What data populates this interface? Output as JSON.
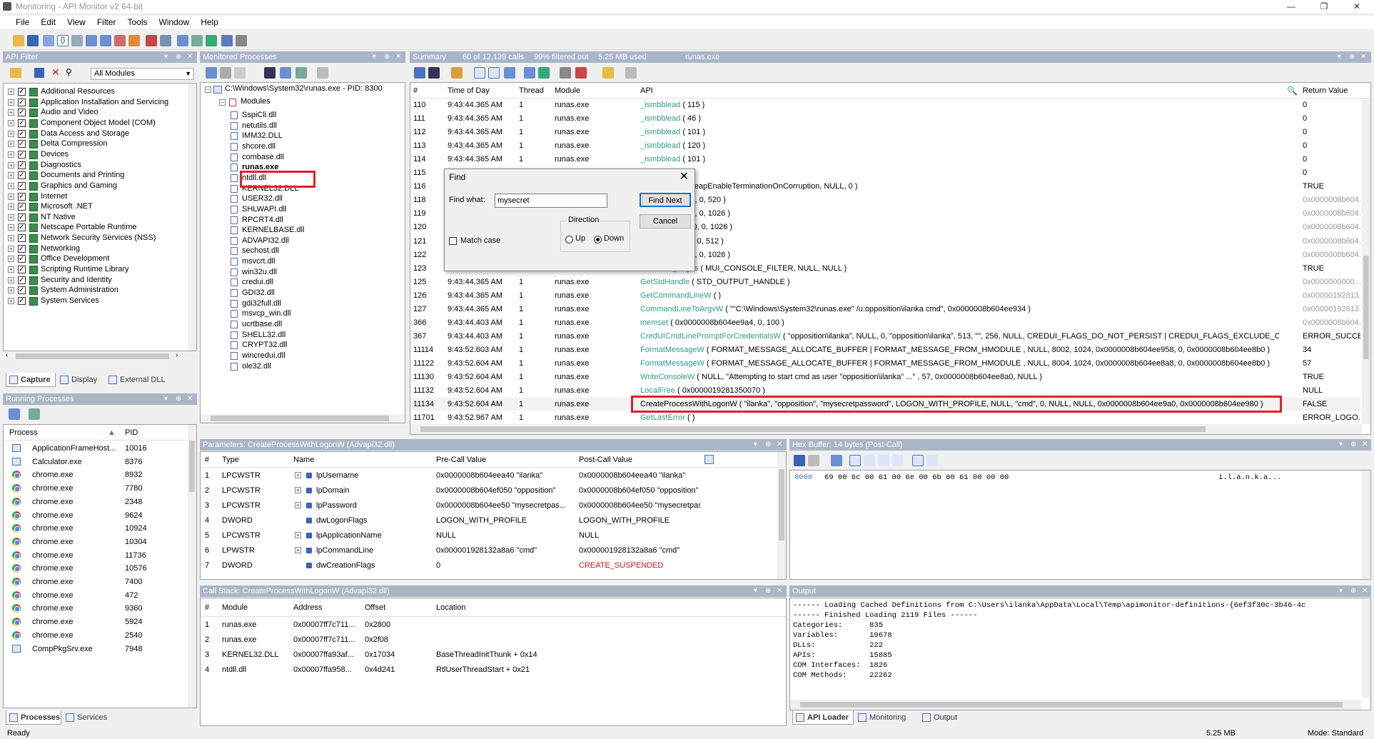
{
  "window": {
    "title": "Monitoring - API Monitor v2 64-bit"
  },
  "menu": [
    "File",
    "Edit",
    "View",
    "Filter",
    "Tools",
    "Window",
    "Help"
  ],
  "api_filter": {
    "header": "API Filter",
    "dropdown": "All Modules",
    "items": [
      "Additional Resources",
      "Application Installation and Servicing",
      "Audio and Video",
      "Component Object Model (COM)",
      "Data Access and Storage",
      "Delta Compression",
      "Devices",
      "Diagnostics",
      "Documents and Printing",
      "Graphics and Gaming",
      "Internet",
      "Microsoft .NET",
      "NT Native",
      "Netscape Portable Runtime",
      "Network Security Services (NSS)",
      "Networking",
      "Office Development",
      "Scripting Runtime Library",
      "Security and Identity",
      "System Administration",
      "System Services"
    ],
    "tabs": [
      "Capture",
      "Display",
      "External DLL"
    ]
  },
  "monitored": {
    "header": "Monitored Processes",
    "root": "C:\\Windows\\System32\\runas.exe - PID: 8300",
    "modules_label": "Modules",
    "modules": [
      "SspiCli.dll",
      "netutils.dll",
      "IMM32.DLL",
      "shcore.dll",
      "combase.dll",
      "runas.exe",
      "ntdll.dll",
      "KERNEL32.DLL",
      "USER32.dll",
      "SHLWAPI.dll",
      "RPCRT4.dll",
      "KERNELBASE.dll",
      "ADVAPI32.dll",
      "sechost.dll",
      "msvcrt.dll",
      "win32u.dll",
      "credui.dll",
      "GDI32.dll",
      "gdi32full.dll",
      "msvcp_win.dll",
      "ucrtbase.dll",
      "SHELL32.dll",
      "CRYPT32.dll",
      "wincredui.dll",
      "ole32.dll"
    ]
  },
  "running": {
    "header": "Running Processes",
    "col_process": "Process",
    "col_pid": "PID",
    "rows": [
      {
        "name": "ApplicationFrameHost...",
        "pid": "10016",
        "icon": "window-icon"
      },
      {
        "name": "Calculator.exe",
        "pid": "8376",
        "icon": "window-icon"
      },
      {
        "name": "chrome.exe",
        "pid": "8932",
        "icon": "chrome-icon"
      },
      {
        "name": "chrome.exe",
        "pid": "7780",
        "icon": "chrome-icon"
      },
      {
        "name": "chrome.exe",
        "pid": "2348",
        "icon": "chrome-icon"
      },
      {
        "name": "chrome.exe",
        "pid": "9624",
        "icon": "chrome-icon"
      },
      {
        "name": "chrome.exe",
        "pid": "10924",
        "icon": "chrome-icon"
      },
      {
        "name": "chrome.exe",
        "pid": "10304",
        "icon": "chrome-icon"
      },
      {
        "name": "chrome.exe",
        "pid": "11736",
        "icon": "chrome-icon"
      },
      {
        "name": "chrome.exe",
        "pid": "10576",
        "icon": "chrome-icon"
      },
      {
        "name": "chrome.exe",
        "pid": "7400",
        "icon": "chrome-icon"
      },
      {
        "name": "chrome.exe",
        "pid": "472",
        "icon": "chrome-icon"
      },
      {
        "name": "chrome.exe",
        "pid": "9360",
        "icon": "chrome-icon"
      },
      {
        "name": "chrome.exe",
        "pid": "5924",
        "icon": "chrome-icon"
      },
      {
        "name": "chrome.exe",
        "pid": "2540",
        "icon": "chrome-icon"
      },
      {
        "name": "CompPkgSrv.exe",
        "pid": "7948",
        "icon": "window-icon"
      }
    ],
    "tabs": [
      "Processes",
      "Services"
    ]
  },
  "summary": {
    "header_parts": [
      "Summary",
      "60 of 12,139 calls",
      "99% filtered out",
      "5.25 MB used",
      "runas.exe"
    ],
    "columns": [
      "#",
      "Time of Day",
      "Thread",
      "Module",
      "API",
      "Return Value"
    ],
    "rows": [
      {
        "n": "110",
        "t": "9:43:44.365 AM",
        "th": "1",
        "m": "runas.exe",
        "api": "_ismbblead",
        "args": " ( 115 )",
        "ret": "0"
      },
      {
        "n": "111",
        "t": "9:43:44.365 AM",
        "th": "1",
        "m": "runas.exe",
        "api": "_ismbblead",
        "args": " ( 46 )",
        "ret": "0"
      },
      {
        "n": "112",
        "t": "9:43:44.365 AM",
        "th": "1",
        "m": "runas.exe",
        "api": "_ismbblead",
        "args": " ( 101 )",
        "ret": "0"
      },
      {
        "n": "113",
        "t": "9:43:44.365 AM",
        "th": "1",
        "m": "runas.exe",
        "api": "_ismbblead",
        "args": " ( 120 )",
        "ret": "0"
      },
      {
        "n": "114",
        "t": "9:43:44.365 AM",
        "th": "1",
        "m": "runas.exe",
        "api": "_ismbblead",
        "args": " ( 101 )",
        "ret": "0"
      },
      {
        "n": "115",
        "t": "",
        "th": "",
        "m": "",
        "api": "",
        "args": "",
        "ret": "0"
      },
      {
        "n": "116",
        "t": "",
        "th": "",
        "m": "",
        "api": "ation",
        "args": " ( NULL, HeapEnableTerminationOnCorruption, NULL, 0 )",
        "ret": "TRUE"
      },
      {
        "n": "118",
        "t": "",
        "th": "",
        "m": "",
        "api": "",
        "args": "0008b604ef050, 0, 520 )",
        "ret": "0x0000008b604..."
      },
      {
        "n": "119",
        "t": "",
        "th": "",
        "m": "",
        "api": "",
        "args": "0008b604ef260, 0, 1026 )",
        "ret": "0x0000008b604..."
      },
      {
        "n": "120",
        "t": "",
        "th": "",
        "m": "",
        "api": "",
        "args": "0008b604eea40, 0, 1026 )",
        "ret": "0x0000008b604..."
      },
      {
        "n": "121",
        "t": "",
        "th": "",
        "m": "",
        "api": "",
        "args": "0008b604ee50, 0, 512 )",
        "ret": "0x0000008b604..."
      },
      {
        "n": "122",
        "t": "",
        "th": "",
        "m": "",
        "api": "",
        "args": "0008b604ef670, 0, 1026 )",
        "ret": "0x0000008b604..."
      },
      {
        "n": "123",
        "t": "",
        "th": "",
        "m": "",
        "api": "redUILanguages",
        "args": " ( MUI_CONSOLE_FILTER, NULL, NULL )",
        "ret": "TRUE"
      },
      {
        "n": "125",
        "t": "9:43:44.365 AM",
        "th": "1",
        "m": "runas.exe",
        "api": "GetStdHandle",
        "args": " ( STD_OUTPUT_HANDLE )",
        "ret": "0x0000000000..."
      },
      {
        "n": "126",
        "t": "9:43:44.365 AM",
        "th": "1",
        "m": "runas.exe",
        "api": "GetCommandLineW",
        "args": " ( )",
        "ret": "0x00000192813..."
      },
      {
        "n": "127",
        "t": "9:43:44.365 AM",
        "th": "1",
        "m": "runas.exe",
        "api": "CommandLineToArgvW",
        "args": " ( \"\"C:\\Windows\\System32\\runas.exe\" /u:opposition\\ilanka cmd\", 0x0000008b604ee934 )",
        "ret": "0x00000192813..."
      },
      {
        "n": "366",
        "t": "9:43:44.403 AM",
        "th": "1",
        "m": "runas.exe",
        "api": "memset",
        "args": " ( 0x0000008b604ee9a4, 0, 100 )",
        "ret": "0x0000008b604..."
      },
      {
        "n": "367",
        "t": "9:43:44.403 AM",
        "th": "1",
        "m": "runas.exe",
        "api": "CredUICmdLinePromptForCredentialsW",
        "args": " ( \"opposition\\ilanka\", NULL, 0, \"opposition\\ilanka\", 513, \"\", 256, NULL, CREDUI_FLAGS_DO_NOT_PERSIST | CREDUI_FLAGS_EXCLUDE_CERTIF...",
        "ret": "ERROR_SUCCESS"
      },
      {
        "n": "11114",
        "t": "9:43:52.603 AM",
        "th": "1",
        "m": "runas.exe",
        "api": "FormatMessageW",
        "args": " ( FORMAT_MESSAGE_ALLOCATE_BUFFER | FORMAT_MESSAGE_FROM_HMODULE , NULL, 8002, 1024, 0x0000008b604ee958, 0, 0x0000008b604ee8b0 )",
        "ret": "34"
      },
      {
        "n": "11122",
        "t": "9:43:52.604 AM",
        "th": "1",
        "m": "runas.exe",
        "api": "FormatMessageW",
        "args": " ( FORMAT_MESSAGE_ALLOCATE_BUFFER | FORMAT_MESSAGE_FROM_HMODULE , NULL, 8004, 1024, 0x0000008b604ee8a8, 0, 0x0000008b604ee8b0 )",
        "ret": "57"
      },
      {
        "n": "11130",
        "t": "9:43:52.604 AM",
        "th": "1",
        "m": "runas.exe",
        "api": "WriteConsoleW",
        "args": " ( NULL, \"Attempting to start cmd as user \"opposition\\ilanka\" ...\" , 57, 0x0000008b604ee8a0, NULL )",
        "ret": "TRUE"
      },
      {
        "n": "11132",
        "t": "9:43:52.604 AM",
        "th": "1",
        "m": "runas.exe",
        "api": "LocalFree",
        "args": " ( 0x0000019281350070 )",
        "ret": "NULL"
      },
      {
        "n": "11134",
        "t": "9:43:52.604 AM",
        "th": "1",
        "m": "runas.exe",
        "api": "CreateProcessWithLogonW",
        "args": " ( \"ilanka\", \"opposition\", \"mysecretpassword\", LOGON_WITH_PROFILE, NULL, \"cmd\", 0, NULL, NULL, 0x0000008b604ee9a0, 0x0000008b604ee980 )",
        "ret": "FALSE"
      },
      {
        "n": "11701",
        "t": "9:43:52.967 AM",
        "th": "1",
        "m": "runas.exe",
        "api": "GetLastError",
        "args": " ( )",
        "ret": "ERROR_LOGO..."
      }
    ]
  },
  "find": {
    "title": "Find",
    "label": "Find what:",
    "value": "mysecret",
    "find_next": "Find Next",
    "cancel": "Cancel",
    "direction": "Direction",
    "up": "Up",
    "down": "Down",
    "match_case": "Match case"
  },
  "params": {
    "header": "Parameters: CreateProcessWithLogonW (Advapi32.dll)",
    "columns": [
      "#",
      "Type",
      "Name",
      "Pre-Call Value",
      "Post-Call Value"
    ],
    "rows": [
      {
        "n": "1",
        "type": "LPCWSTR",
        "name": "lpUsername",
        "pre": "0x0000008b604eea40 \"ilanka\"",
        "post": "0x0000008b604eea40 \"ilanka\"",
        "exp": true
      },
      {
        "n": "2",
        "type": "LPCWSTR",
        "name": "lpDomain",
        "pre": "0x0000008b604ef050 \"opposition\"",
        "post": "0x0000008b604ef050 \"opposition\"",
        "exp": true
      },
      {
        "n": "3",
        "type": "LPCWSTR",
        "name": "lpPassword",
        "pre": "0x0000008b604ee50 \"mysecretpas...",
        "post": "0x0000008b604ee50 \"mysecretpas...",
        "exp": true
      },
      {
        "n": "4",
        "type": "DWORD",
        "name": "dwLogonFlags",
        "pre": "LOGON_WITH_PROFILE",
        "post": "LOGON_WITH_PROFILE",
        "exp": false
      },
      {
        "n": "5",
        "type": "LPCWSTR",
        "name": "lpApplicationName",
        "pre": "NULL",
        "post": "NULL",
        "exp": true
      },
      {
        "n": "6",
        "type": "LPWSTR",
        "name": "lpCommandLine",
        "pre": "0x000001928132a8a6 \"cmd\"",
        "post": "0x000001928132a8a6 \"cmd\"",
        "exp": true
      },
      {
        "n": "7",
        "type": "DWORD",
        "name": "dwCreationFlags",
        "pre": "0",
        "post": "CREATE_SUSPENDED",
        "exp": false
      }
    ]
  },
  "hex": {
    "header": "Hex Buffer: 14 bytes (Post-Call)",
    "offset": "0000",
    "bytes": "69 00 6c 00 61 00 6e 00 6b 00 61 00 00 00",
    "ascii": "i.l.a.n.k.a..."
  },
  "callstack": {
    "header": "Call Stack: CreateProcessWithLogonW (Advapi32.dll)",
    "columns": [
      "#",
      "Module",
      "Address",
      "Offset",
      "Location"
    ],
    "rows": [
      {
        "n": "1",
        "module": "runas.exe",
        "addr": "0x00007ff7c711...",
        "off": "0x2800",
        "loc": ""
      },
      {
        "n": "2",
        "module": "runas.exe",
        "addr": "0x00007ff7c711...",
        "off": "0x2f08",
        "loc": ""
      },
      {
        "n": "3",
        "module": "KERNEL32.DLL",
        "addr": "0x00007ffa93af...",
        "off": "0x17034",
        "loc": "BaseThreadInitThunk + 0x14"
      },
      {
        "n": "4",
        "module": "ntdll.dll",
        "addr": "0x00007ffa958...",
        "off": "0x4d241",
        "loc": "RtlUserThreadStart + 0x21"
      }
    ]
  },
  "output": {
    "header": "Output",
    "lines": [
      "------ Loading Cached Definitions from C:\\Users\\ilanka\\AppData\\Local\\Temp\\apimonitor-definitions-{6ef3f30c-3b46-4c",
      "------ Finished Loading 2119 Files ------",
      "Categories:      835",
      "Variables:       19678",
      "DLLs:            222",
      "APIs:            15885",
      "COM Interfaces:  1826",
      "COM Methods:     22262"
    ],
    "tabs": [
      "API Loader",
      "Monitoring",
      "Output"
    ]
  },
  "status": {
    "left": "Ready",
    "size": "5.25 MB",
    "mode": "Mode: Standard"
  }
}
